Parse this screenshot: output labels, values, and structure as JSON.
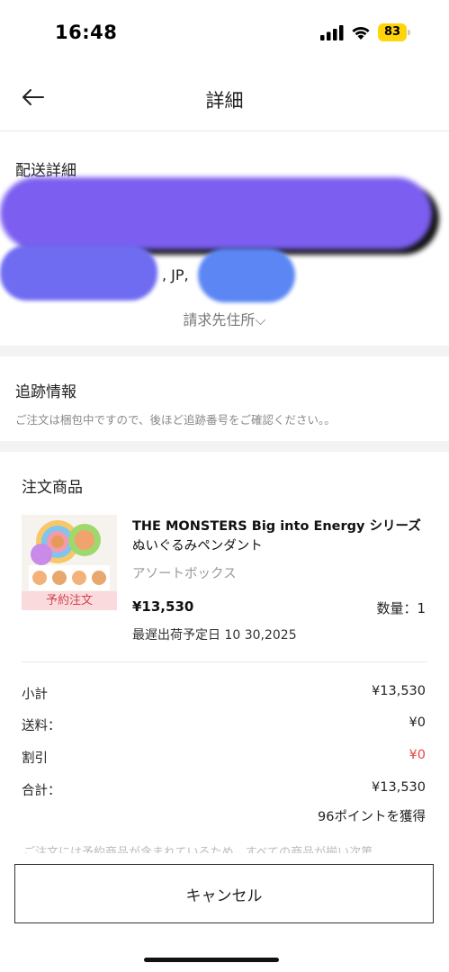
{
  "status_bar": {
    "time": "16:48",
    "battery": "83"
  },
  "header": {
    "title": "詳細"
  },
  "delivery": {
    "title": "配送詳細",
    "address_fragment": ", JP,",
    "billing_link": "請求先住所⌵"
  },
  "tracking": {
    "title": "追跡情報",
    "note": "ご注文は梱包中ですので、後ほど追跡番号をご確認ください。。"
  },
  "order_items": {
    "title": "注文商品",
    "product": {
      "name_line1": "THE MONSTERS Big into Energy シリーズ",
      "name_line2": "ぬいぐるみペンダント",
      "variant": "アソートボックス",
      "badge": "予約注文",
      "price": "¥13,530",
      "quantity": "数量：1",
      "ship_date": "最遅出荷予定日 10 30,2025"
    }
  },
  "summary": {
    "subtotal_label": "小計",
    "subtotal_value": "¥13,530",
    "shipping_label": "送料：",
    "shipping_value": "¥0",
    "discount_label": "割引",
    "discount_value": "¥0",
    "total_label": "合計：",
    "total_value": "¥13,530",
    "points": "96ポイントを獲得",
    "note_cut": "ご注文には予約商品が含まれているため、すべての商品が揃い次第"
  },
  "actions": {
    "cancel_label": "キャンセル"
  },
  "colors": {
    "discount_red": "#e2474b",
    "badge_bg": "#fadadd",
    "redaction_purple": "#7c5ef0",
    "redaction_blue": "#5b86f4"
  }
}
